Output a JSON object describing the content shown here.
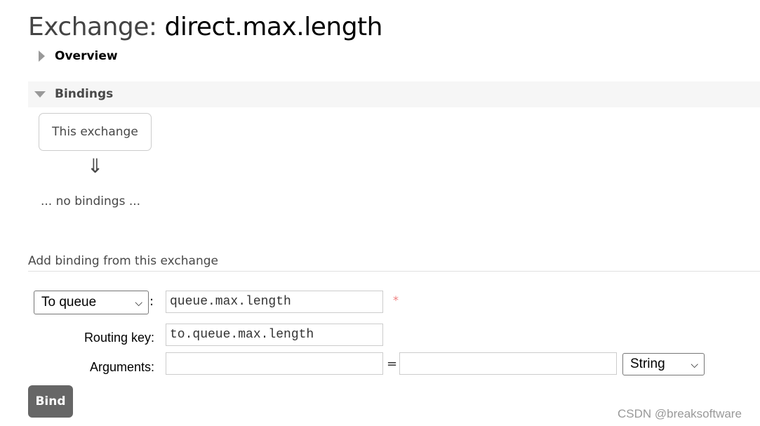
{
  "title": {
    "prefix": "Exchange:",
    "name": "direct.max.length"
  },
  "sections": {
    "overview": "Overview",
    "bindings": "Bindings"
  },
  "bindings": {
    "this_exchange": "This exchange",
    "arrow": "⇓",
    "empty": "... no bindings ..."
  },
  "add_binding": {
    "heading": "Add binding from this exchange",
    "destination_type": "To queue",
    "destination_value": "queue.max.length",
    "required_marker": "*",
    "routing_key_label": "Routing key:",
    "routing_key_value": "to.queue.max.length",
    "arguments_label": "Arguments:",
    "arguments_key": "",
    "equals": "=",
    "arguments_value": "",
    "arguments_type": "String",
    "bind_label": "Bind"
  },
  "watermark": "CSDN @breaksoftware"
}
